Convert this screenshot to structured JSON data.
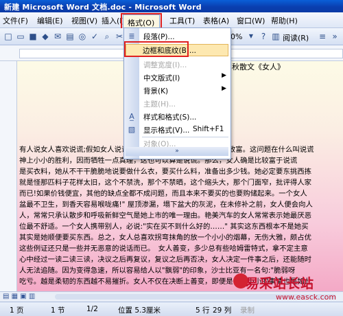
{
  "window": {
    "title": "新建 Microsoft Word 文档.doc - Microsoft Word"
  },
  "menubar": {
    "items": [
      "文件(F)",
      "编辑(E)",
      "视图(V)",
      "插入(I)",
      "格式(O)",
      "工具(T)",
      "表格(A)",
      "窗口(W)",
      "帮助(H)"
    ],
    "active": "格式(O)"
  },
  "toolbar": {
    "zoom": "0%",
    "reading_label": "阅读(R)"
  },
  "format_menu": {
    "items": [
      {
        "label": "段落(P)...",
        "icon": "paragraph-icon",
        "enabled": true
      },
      {
        "label": "边框和底纹(B)...",
        "icon": "",
        "enabled": true,
        "highlighted": true
      },
      {
        "label": "调整宽度(I)...",
        "icon": "",
        "enabled": false
      },
      {
        "label": "中文版式(I)",
        "icon": "",
        "enabled": true,
        "submenu": true
      },
      {
        "label": "背景(K)",
        "icon": "",
        "enabled": true,
        "submenu": true
      },
      {
        "label": "主题(H)...",
        "icon": "",
        "enabled": false
      },
      {
        "label": "样式和格式(S)...",
        "icon": "styles-icon",
        "enabled": true
      },
      {
        "label": "显示格式(V)...",
        "icon": "reveal-format-icon",
        "enabled": true,
        "shortcut": "Shift+F1"
      },
      {
        "label": "对象(O)...",
        "icon": "",
        "enabled": false
      }
    ],
    "expand_label": "»"
  },
  "document": {
    "title": "梁实秋散文《女人》",
    "lines": [
      "有人说女人喜欢说谎;假如女人说谎的是大家，她们也没有必要容易致富。这问题在什么叫说谎",
      "神上小小的胜利，因而牺牲一点真理，这也可以算是说谎。那么，女人确是比较富于说谎",
      "是买衣料，她从不干干脆脆地说要做什么衣，要买什么料，准备出多少钱。她必定要东挑西拣",
      "就是怪那匹料子花样太旧，这个不禁洗，那个不禁晒，这个缩头大，那个门面窄，批评得人家",
      "而已!如果价钱便宜，其他的缺点全都不成问题，而且本来不要买的也要购储起来。一个女人",
      "盆最不卫生，到香天容易喉咙痛!\" 屋顶渗漏，塌下盆大的灰泥，在未修补之前，女人便会向人",
      "人，常常只承认散步和呼吸新鲜空气是她上市的唯一理由。艳美汽车的女人常常表示她最厌恶",
      "位最不舒适。一个女人携带别人，必说:\"实在买不到什么好的……\" 其实这东西根本不是她买",
      "其实是她顺便要买东西。总之，女人总喜欢拐弯抹角的放一个小小的烟幕，无伤大雅，颇占优",
      "这些例证还只是一些并无恶意的说话而已。　女人善变，多少总有些哈姆雷特式，拿不定主意",
      "心中经过一读二读三读，决议之后再复议，复议之后再否决，女人决定一件事之后，还能随时",
      "人无法追随。因为变得急速，所以容易给人以\"飘弱\"的印象，沙士比亚有一名句:\"脆弱呀",
      "吃亏。越是柔韧的东西越不易摧折。女人不仅在决断上善变，即便是一个小小的事情也是如此"
    ]
  },
  "status": {
    "page": "1 页",
    "section": "1 节",
    "page_of": "1/2",
    "position": "位置 5.3厘米",
    "line": "5 行",
    "column": "29 列",
    "rec": "录制"
  },
  "watermark": {
    "text": "易采站长站",
    "url": "www.easck.com"
  }
}
